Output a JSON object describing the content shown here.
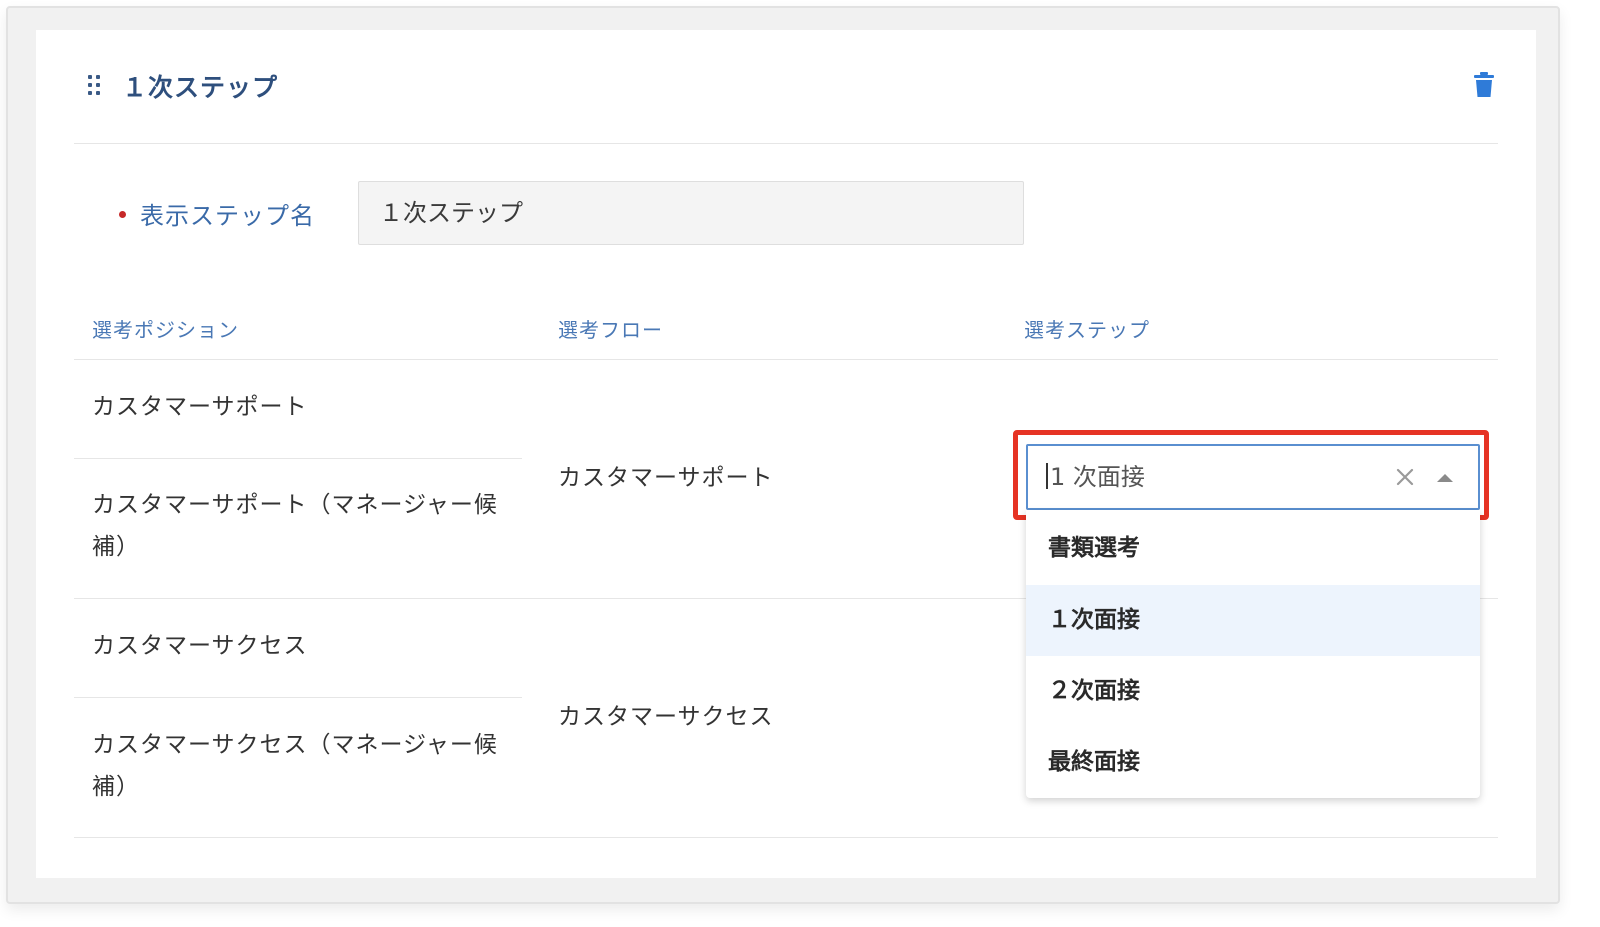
{
  "step_card": {
    "title": "１次ステップ",
    "display_name_label": "表示ステップ名",
    "display_name_value": "１次ステップ"
  },
  "table": {
    "headers": [
      "選考ポジション",
      "選考フロー",
      "選考ステップ"
    ],
    "positions": [
      "カスタマーサポート",
      "カスタマーサポート（マネージャー候補）",
      "カスタマーサクセス",
      "カスタマーサクセス（マネージャー候補）"
    ],
    "flows": [
      "カスタマーサポート",
      "カスタマーサクセス"
    ]
  },
  "step_select": {
    "value": "1 次面接",
    "options": [
      "書類選考",
      "１次面接",
      "２次面接",
      "最終面接"
    ],
    "highlighted_index": 1
  },
  "colors": {
    "accent": "#4a78b5",
    "title": "#2e4f7d",
    "required": "#c62828",
    "highlight_border": "#e63324",
    "focus_border": "#5a8fd0",
    "option_hover": "#edf4fd"
  },
  "icons": [
    "drag-handle-icon",
    "trash-icon",
    "clear-icon",
    "arrow-up-icon"
  ]
}
